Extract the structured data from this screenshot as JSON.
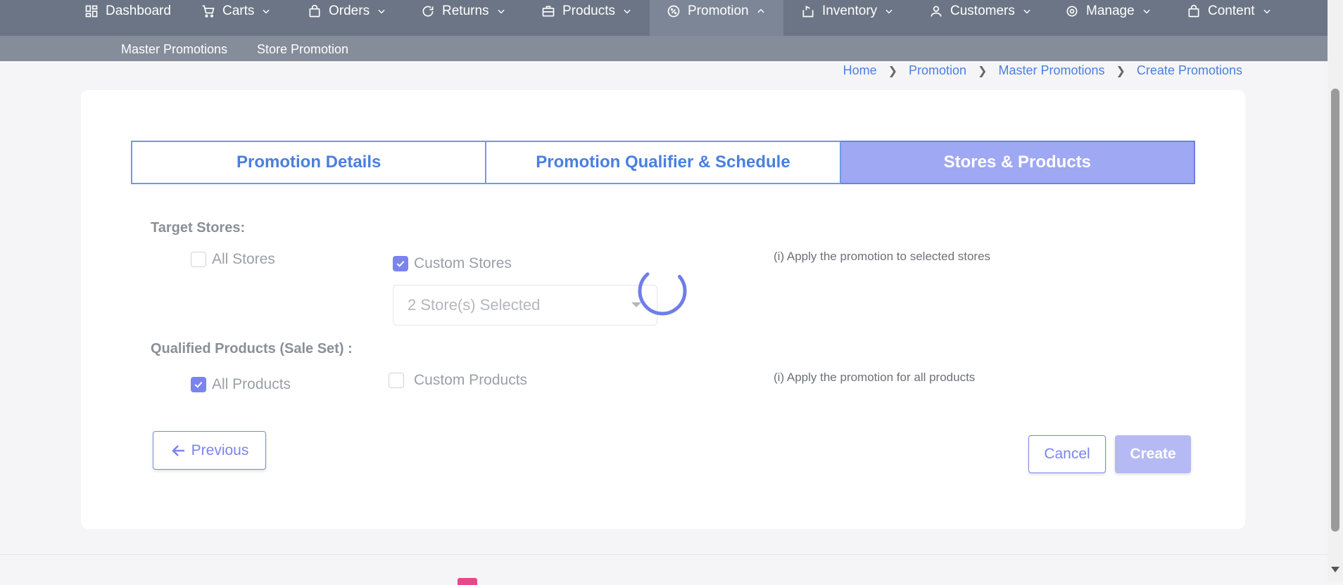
{
  "nav": {
    "items": [
      {
        "label": "Dashboard",
        "icon": "dashboard-icon",
        "has_chevron": false
      },
      {
        "label": "Carts",
        "icon": "cart-icon",
        "has_chevron": true
      },
      {
        "label": "Orders",
        "icon": "bag-icon",
        "has_chevron": true
      },
      {
        "label": "Returns",
        "icon": "refresh-icon",
        "has_chevron": true
      },
      {
        "label": "Products",
        "icon": "briefcase-icon",
        "has_chevron": true
      },
      {
        "label": "Promotion",
        "icon": "promotion-icon",
        "has_chevron": true,
        "active": true
      },
      {
        "label": "Inventory",
        "icon": "inventory-icon",
        "has_chevron": true
      },
      {
        "label": "Customers",
        "icon": "user-icon",
        "has_chevron": true
      },
      {
        "label": "Manage",
        "icon": "gear-icon",
        "has_chevron": true
      },
      {
        "label": "Content",
        "icon": "bag-icon",
        "has_chevron": true
      }
    ],
    "sub_items": [
      "Master Promotions",
      "Store Promotion"
    ]
  },
  "breadcrumb": [
    "Home",
    "Promotion",
    "Master Promotions",
    "Create Promotions"
  ],
  "tabs": [
    {
      "label": "Promotion Details",
      "active": false
    },
    {
      "label": "Promotion Qualifier & Schedule",
      "active": false
    },
    {
      "label": "Stores & Products",
      "active": true
    }
  ],
  "target_stores": {
    "label": "Target Stores:",
    "all_stores": {
      "label": "All Stores",
      "checked": false
    },
    "custom_stores": {
      "label": "Custom Stores",
      "checked": true
    },
    "select_value": "2 Store(s) Selected",
    "hint": "(i) Apply the promotion to selected stores"
  },
  "qualified_products": {
    "label": "Qualified Products (Sale Set) :",
    "all_products": {
      "label": "All Products",
      "checked": true
    },
    "custom_products": {
      "label": "Custom Products",
      "checked": false
    },
    "hint": "(i) Apply the promotion for all products"
  },
  "buttons": {
    "previous": "Previous",
    "cancel": "Cancel",
    "create": "Create"
  },
  "colors": {
    "accent": "#7b84ee",
    "nav_bg": "#6b7585",
    "link": "#4a7fe0"
  }
}
